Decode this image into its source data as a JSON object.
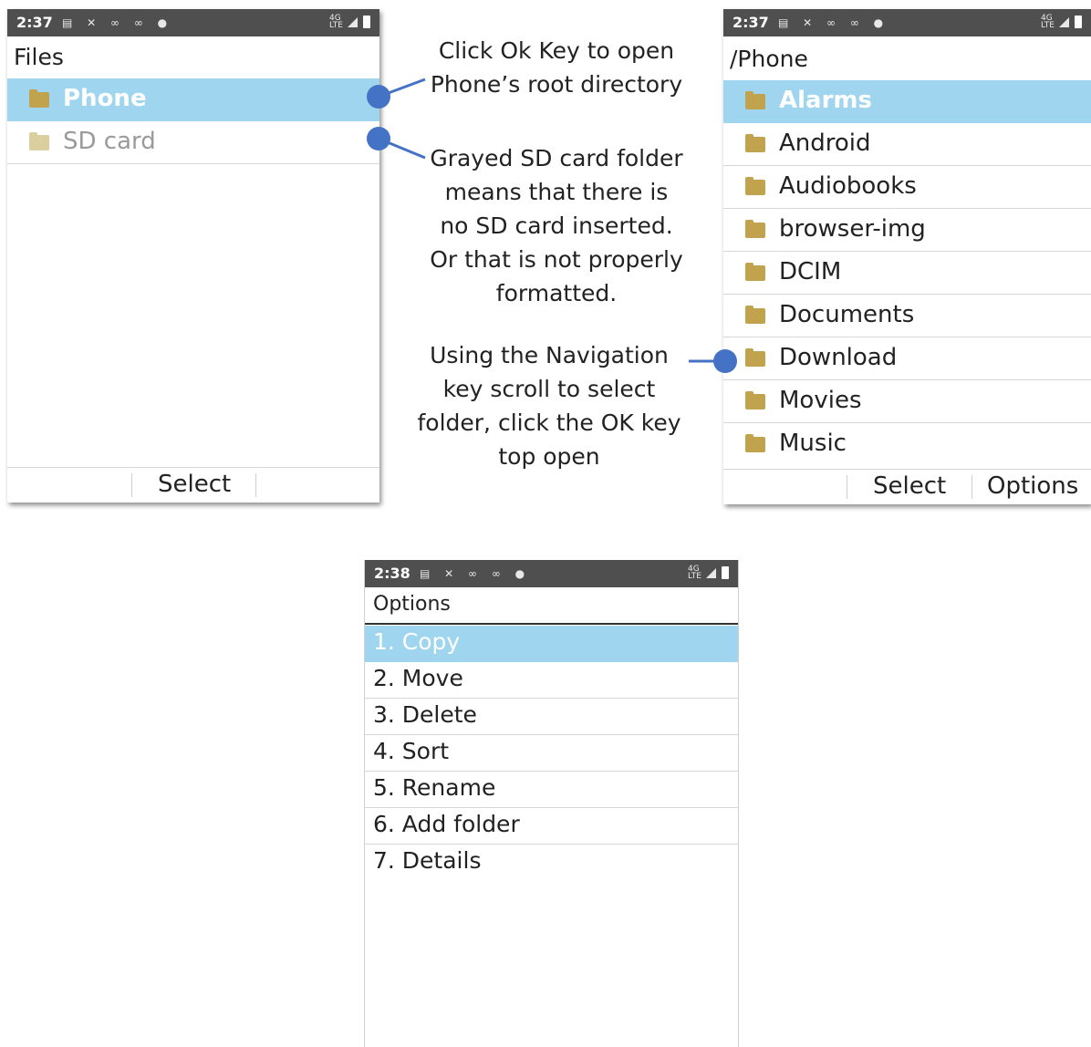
{
  "screen_files": {
    "status_time": "2:37",
    "title": "Files",
    "items": [
      {
        "label": "Phone",
        "icon": "folder-icon",
        "selected": true
      },
      {
        "label": "SD card",
        "icon": "folder-icon",
        "grayed": true
      }
    ],
    "softkey_center": "Select"
  },
  "screen_phone": {
    "status_time": "2:37",
    "title": "/Phone",
    "items": [
      {
        "label": "Alarms",
        "icon": "folder-icon",
        "selected": true
      },
      {
        "label": "Android",
        "icon": "folder-icon"
      },
      {
        "label": "Audiobooks",
        "icon": "folder-icon"
      },
      {
        "label": "browser-img",
        "icon": "folder-icon"
      },
      {
        "label": "DCIM",
        "icon": "folder-icon"
      },
      {
        "label": "Documents",
        "icon": "folder-icon"
      },
      {
        "label": "Download",
        "icon": "folder-icon"
      },
      {
        "label": "Movies",
        "icon": "folder-icon"
      },
      {
        "label": "Music",
        "icon": "folder-icon"
      }
    ],
    "softkey_center": "Select",
    "softkey_right": "Options"
  },
  "screen_options": {
    "status_time": "2:38",
    "title": "Options",
    "items": [
      {
        "label": "1. Copy",
        "selected": true
      },
      {
        "label": "2. Move"
      },
      {
        "label": "3. Delete"
      },
      {
        "label": "4. Sort"
      },
      {
        "label": "5. Rename"
      },
      {
        "label": "6. Add folder"
      },
      {
        "label": "7. Details"
      }
    ]
  },
  "annotations": {
    "ok_key": [
      "Click Ok Key to open",
      "Phone’s root directory"
    ],
    "sd_card": [
      "Grayed SD card folder",
      "means that there is",
      "no SD card inserted.",
      "Or that is not properly",
      "formatted."
    ],
    "navigation": [
      "Using the Navigation",
      "key scroll to select",
      "folder, click the OK key",
      "top open"
    ]
  },
  "colors": {
    "highlight": "#9fd5ee",
    "status_bar": "#4f4f4f",
    "folder": "#c2a34d",
    "callout": "#4472c4"
  }
}
